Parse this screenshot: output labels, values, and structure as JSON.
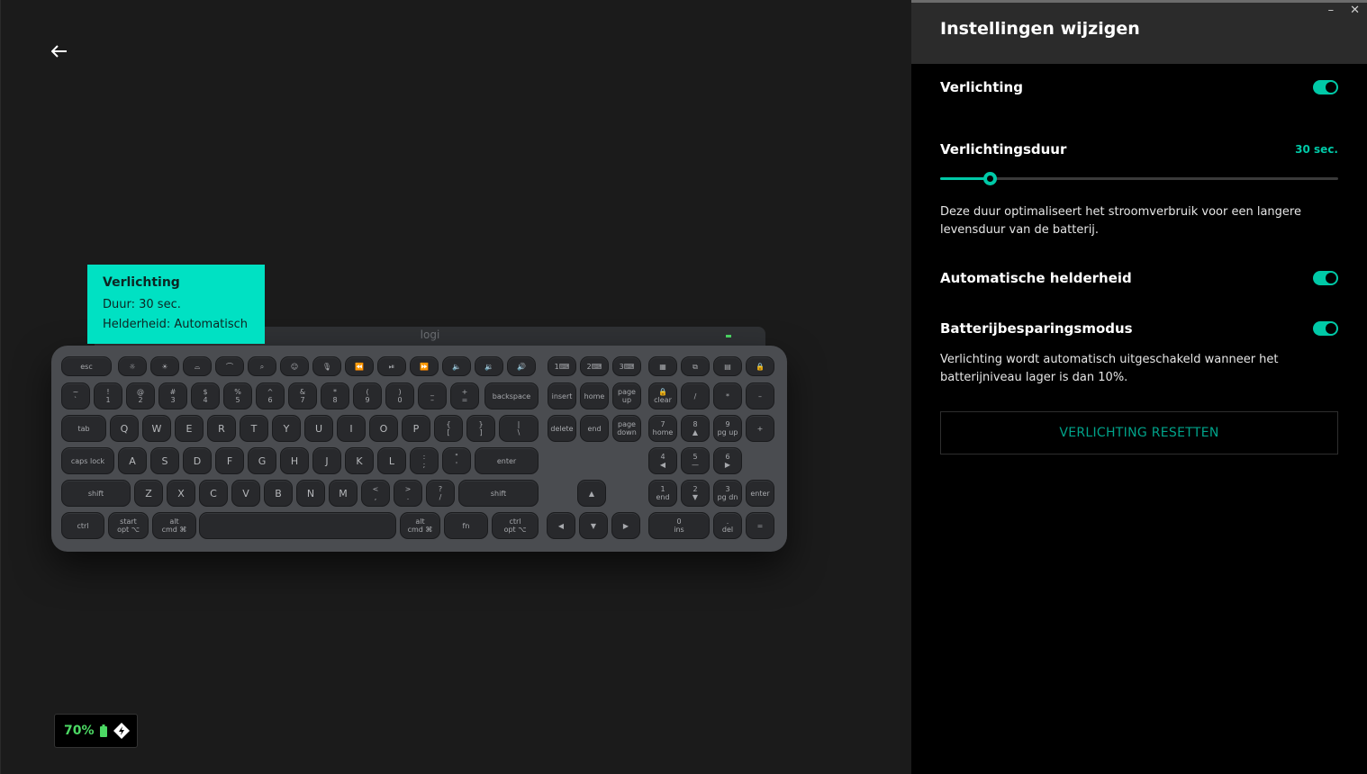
{
  "header": {
    "title": "Instellingen wijzigen",
    "minimize_label": "–",
    "close_label": "✕"
  },
  "tooltip": {
    "title": "Verlichting",
    "duration": "Duur: 30 sec.",
    "brightness": "Helderheid: Automatisch"
  },
  "keyboard": {
    "logo": "logi",
    "fn_row": [
      {
        "top": "esc",
        "bottom": ""
      },
      {
        "top": "☼",
        "bottom": ""
      },
      {
        "top": "☀",
        "bottom": ""
      },
      {
        "top": "⌓",
        "bottom": ""
      },
      {
        "top": "⌒",
        "bottom": ""
      },
      {
        "top": "⌕",
        "bottom": ""
      },
      {
        "top": "☺",
        "bottom": ""
      },
      {
        "top": "🎙",
        "bottom": ""
      },
      {
        "top": "⏪",
        "bottom": ""
      },
      {
        "top": "⏯",
        "bottom": ""
      },
      {
        "top": "⏩",
        "bottom": ""
      },
      {
        "top": "🔈",
        "bottom": ""
      },
      {
        "top": "🔉",
        "bottom": ""
      },
      {
        "top": "🔊",
        "bottom": ""
      },
      {
        "top": "1⌨",
        "bottom": ""
      },
      {
        "top": "2⌨",
        "bottom": ""
      },
      {
        "top": "3⌨",
        "bottom": ""
      },
      {
        "top": "▦",
        "bottom": ""
      },
      {
        "top": "⧉",
        "bottom": ""
      },
      {
        "top": "▤",
        "bottom": ""
      },
      {
        "top": "🔒",
        "bottom": ""
      }
    ],
    "num_row": [
      {
        "top": "~",
        "bottom": "`"
      },
      {
        "top": "!",
        "bottom": "1"
      },
      {
        "top": "@",
        "bottom": "2"
      },
      {
        "top": "#",
        "bottom": "3"
      },
      {
        "top": "$",
        "bottom": "4"
      },
      {
        "top": "%",
        "bottom": "5"
      },
      {
        "top": "^",
        "bottom": "6"
      },
      {
        "top": "&",
        "bottom": "7"
      },
      {
        "top": "*",
        "bottom": "8"
      },
      {
        "top": "(",
        "bottom": "9"
      },
      {
        "top": ")",
        "bottom": "0"
      },
      {
        "top": "_",
        "bottom": "–"
      },
      {
        "top": "+",
        "bottom": "="
      },
      {
        "top": "backspace",
        "bottom": ""
      },
      {
        "top": "insert",
        "bottom": ""
      },
      {
        "top": "home",
        "bottom": ""
      },
      {
        "top": "page",
        "bottom": "up"
      },
      {
        "top": "🔒",
        "bottom": "clear"
      },
      {
        "top": "/",
        "bottom": ""
      },
      {
        "top": "*",
        "bottom": ""
      },
      {
        "top": "–",
        "bottom": ""
      }
    ],
    "q_row": [
      {
        "top": "tab",
        "bottom": ""
      },
      {
        "top": "Q",
        "bottom": ""
      },
      {
        "top": "W",
        "bottom": ""
      },
      {
        "top": "E",
        "bottom": ""
      },
      {
        "top": "R",
        "bottom": ""
      },
      {
        "top": "T",
        "bottom": ""
      },
      {
        "top": "Y",
        "bottom": ""
      },
      {
        "top": "U",
        "bottom": ""
      },
      {
        "top": "I",
        "bottom": ""
      },
      {
        "top": "O",
        "bottom": ""
      },
      {
        "top": "P",
        "bottom": ""
      },
      {
        "top": "{",
        "bottom": "["
      },
      {
        "top": "}",
        "bottom": "]"
      },
      {
        "top": "|",
        "bottom": "\\"
      },
      {
        "top": "delete",
        "bottom": ""
      },
      {
        "top": "end",
        "bottom": ""
      },
      {
        "top": "page",
        "bottom": "down"
      },
      {
        "top": "7",
        "bottom": "home"
      },
      {
        "top": "8",
        "bottom": "▲"
      },
      {
        "top": "9",
        "bottom": "pg up"
      },
      {
        "top": "+",
        "bottom": ""
      }
    ],
    "a_row": [
      {
        "top": "caps lock",
        "bottom": ""
      },
      {
        "top": "A",
        "bottom": ""
      },
      {
        "top": "S",
        "bottom": ""
      },
      {
        "top": "D",
        "bottom": ""
      },
      {
        "top": "F",
        "bottom": ""
      },
      {
        "top": "G",
        "bottom": ""
      },
      {
        "top": "H",
        "bottom": ""
      },
      {
        "top": "J",
        "bottom": ""
      },
      {
        "top": "K",
        "bottom": ""
      },
      {
        "top": "L",
        "bottom": ""
      },
      {
        "top": ":",
        "bottom": ";"
      },
      {
        "top": "\"",
        "bottom": "'"
      },
      {
        "top": "enter",
        "bottom": ""
      },
      {
        "top": "4",
        "bottom": "◀"
      },
      {
        "top": "5",
        "bottom": "—"
      },
      {
        "top": "6",
        "bottom": "▶"
      }
    ],
    "z_row": [
      {
        "top": "shift",
        "bottom": ""
      },
      {
        "top": "Z",
        "bottom": ""
      },
      {
        "top": "X",
        "bottom": ""
      },
      {
        "top": "C",
        "bottom": ""
      },
      {
        "top": "V",
        "bottom": ""
      },
      {
        "top": "B",
        "bottom": ""
      },
      {
        "top": "N",
        "bottom": ""
      },
      {
        "top": "M",
        "bottom": ""
      },
      {
        "top": "<",
        "bottom": ","
      },
      {
        "top": ">",
        "bottom": "."
      },
      {
        "top": "?",
        "bottom": "/"
      },
      {
        "top": "shift",
        "bottom": ""
      },
      {
        "top": "▲",
        "bottom": ""
      },
      {
        "top": "1",
        "bottom": "end"
      },
      {
        "top": "2",
        "bottom": "▼"
      },
      {
        "top": "3",
        "bottom": "pg dn"
      },
      {
        "top": "enter",
        "bottom": ""
      }
    ],
    "bottom_row": [
      {
        "top": "ctrl",
        "bottom": ""
      },
      {
        "top": "start",
        "bottom": "opt ⌥"
      },
      {
        "top": "alt",
        "bottom": "cmd ⌘"
      },
      {
        "top": "",
        "bottom": ""
      },
      {
        "top": "alt",
        "bottom": "cmd ⌘"
      },
      {
        "top": "fn",
        "bottom": ""
      },
      {
        "top": "ctrl",
        "bottom": "opt ⌥"
      },
      {
        "top": "◀",
        "bottom": ""
      },
      {
        "top": "▼",
        "bottom": ""
      },
      {
        "top": "▶",
        "bottom": ""
      },
      {
        "top": "0",
        "bottom": "ins"
      },
      {
        "top": ".",
        "bottom": "del"
      },
      {
        "top": "=",
        "bottom": ""
      }
    ]
  },
  "battery": {
    "percent": "70%",
    "icon": "battery-icon",
    "status_icon": "logi-bolt-icon"
  },
  "settings": {
    "lighting": {
      "label": "Verlichting",
      "enabled": true
    },
    "duration": {
      "label": "Verlichtingsduur",
      "value_text": "30 sec.",
      "slider_fraction": 0.125,
      "description": "Deze duur optimaliseert het stroomverbruik voor een langere levensduur van de batterij."
    },
    "auto_brightness": {
      "label": "Automatische helderheid",
      "enabled": true
    },
    "battery_saver": {
      "label": "Batterijbesparingsmodus",
      "enabled": true,
      "description": "Verlichting wordt automatisch uitgeschakeld wanneer het batterijniveau lager is dan 10%."
    },
    "reset_button": "VERLICHTING RESETTEN"
  },
  "colors": {
    "accent": "#00c9a7",
    "tooltip_bg": "#00e1c3",
    "battery_green": "#4cd964",
    "panel_bg": "#000000",
    "left_bg": "#1b1b1b"
  }
}
